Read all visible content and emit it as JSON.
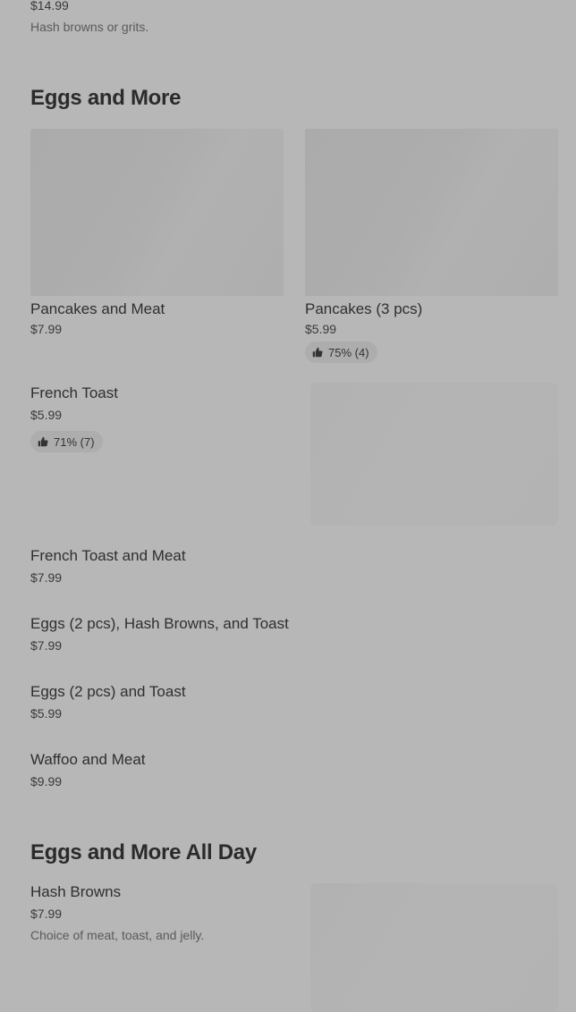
{
  "top_item": {
    "price": "$14.99",
    "description": "Hash browns or grits."
  },
  "sections": [
    {
      "title": "Eggs and More",
      "featured": [
        {
          "name": "Pancakes and  Meat",
          "price": "$7.99"
        },
        {
          "name": "Pancakes (3 pcs)",
          "price": "$5.99",
          "rating": "75% (4)"
        }
      ],
      "items": [
        {
          "name": "French Toast",
          "price": "$5.99",
          "rating": "71% (7)"
        },
        {
          "name": "French Toast and Meat",
          "price": "$7.99"
        },
        {
          "name": "Eggs (2 pcs), Hash Browns, and Toast",
          "price": "$7.99"
        },
        {
          "name": "Eggs (2 pcs) and Toast",
          "price": "$5.99"
        },
        {
          "name": "Waffoo and Meat",
          "price": "$9.99"
        }
      ]
    },
    {
      "title": "Eggs and More All Day",
      "items": [
        {
          "name": "Hash Browns",
          "price": "$7.99",
          "description": "Choice of meat, toast, and jelly."
        }
      ]
    }
  ],
  "icons": {
    "rating": "thumbs-up-icon"
  },
  "colors": {
    "background": "#b7b7b7",
    "text": "#2e2e2e",
    "badge": "#adadad"
  }
}
